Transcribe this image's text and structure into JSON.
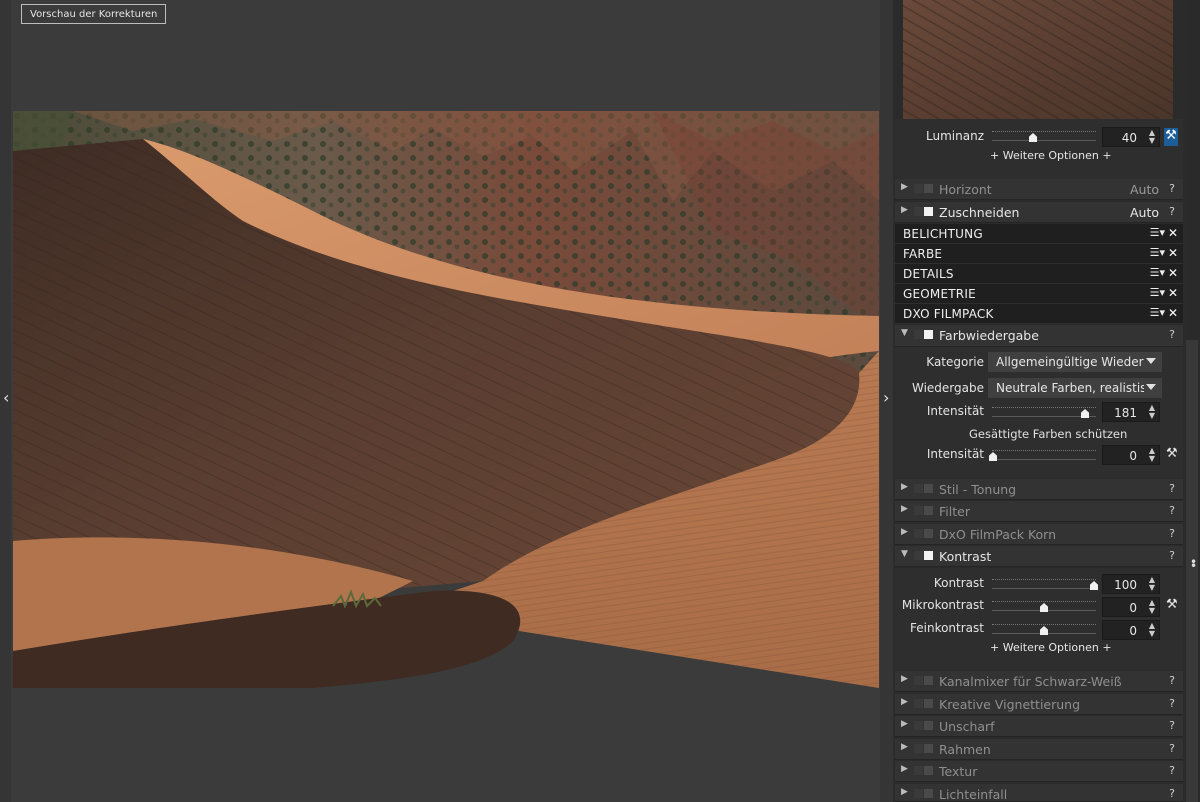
{
  "viewer": {
    "preview_button": "Vorschau der Korrekturen",
    "prev_arrow": "‹",
    "next_arrow": "›"
  },
  "noise": {
    "luminance_label": "Luminanz",
    "luminance_value": "40",
    "luminance_fraction": 0.4,
    "more_options": "+ Weitere Optionen +"
  },
  "tools_top": [
    {
      "name": "Horizont",
      "mode": "Auto",
      "help": "?"
    },
    {
      "name": "Zuschneiden",
      "mode": "Auto",
      "help": "?"
    }
  ],
  "sections": [
    {
      "name": "BELICHTUNG",
      "menu": "☰▾",
      "close": "✕"
    },
    {
      "name": "FARBE",
      "menu": "☰▾",
      "close": "✕"
    },
    {
      "name": "DETAILS",
      "menu": "☰▾",
      "close": "✕"
    },
    {
      "name": "GEOMETRIE",
      "menu": "☰▾",
      "close": "✕"
    },
    {
      "name": "DXO FILMPACK",
      "menu": "☰▾",
      "close": "✕"
    }
  ],
  "color_rendering": {
    "title": "Farbwiedergabe",
    "help": "?",
    "category_label": "Kategorie",
    "category_value": "Allgemeingültige Wiedergal",
    "rendering_label": "Wiedergabe",
    "rendering_value": "Neutrale Farben, realistische",
    "intensity_label": "Intensität",
    "intensity_value": "181",
    "protect_label": "Gesättigte Farben schützen",
    "protect_intensity_label": "Intensität",
    "protect_intensity_value": "0"
  },
  "tools_mid": [
    {
      "name": "Stil - Tonung",
      "help": "?"
    },
    {
      "name": "Filter",
      "help": "?"
    },
    {
      "name": "DxO FilmPack Korn",
      "help": "?"
    }
  ],
  "contrast": {
    "title": "Kontrast",
    "help": "?",
    "contrast_label": "Kontrast",
    "contrast_value": "100",
    "micro_label": "Mikrokontrast",
    "micro_value": "0",
    "fine_label": "Feinkontrast",
    "fine_value": "0",
    "more_options": "+ Weitere Optionen +"
  },
  "tools_bottom": [
    {
      "name": "Kanalmixer für Schwarz-Weiß",
      "help": "?"
    },
    {
      "name": "Kreative Vignettierung",
      "help": "?"
    },
    {
      "name": "Unscharf",
      "help": "?"
    },
    {
      "name": "Rahmen",
      "help": "?"
    },
    {
      "name": "Textur",
      "help": "?"
    },
    {
      "name": "Lichteinfall",
      "help": "?"
    }
  ],
  "colors": {
    "panel_bg": "#2b2b2b",
    "section_bg": "#1f1f1f",
    "accent_blue": "#1d5e9a",
    "dune_light": "#c8875e",
    "dune_shadow": "#5a3e31"
  }
}
